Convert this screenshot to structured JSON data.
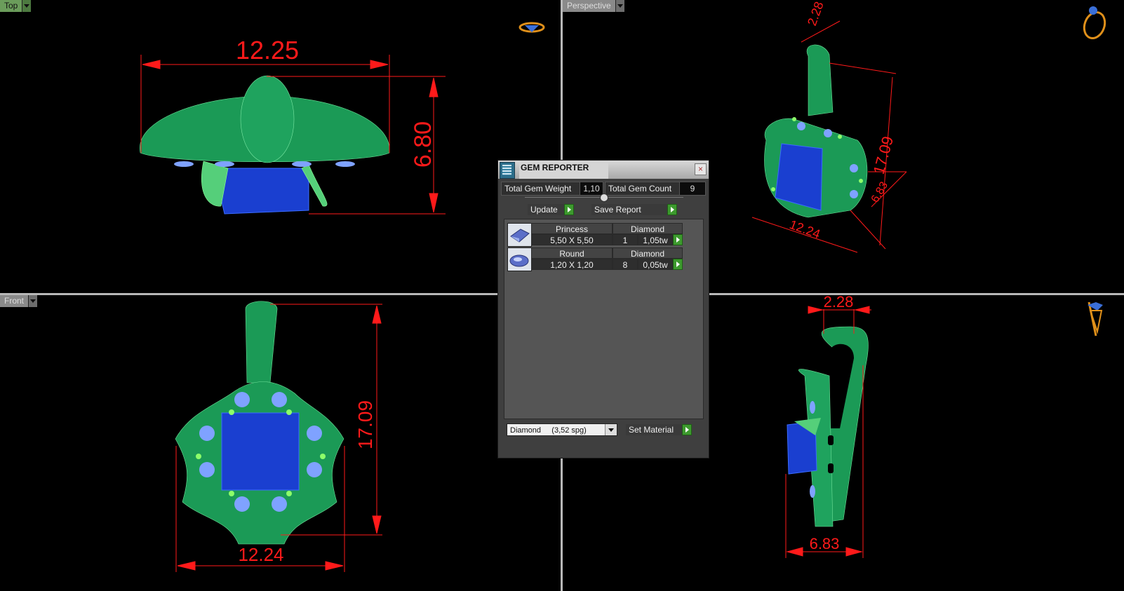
{
  "viewports": {
    "top": {
      "label": "Top"
    },
    "perspective": {
      "label": "Perspective"
    },
    "front": {
      "label": "Front"
    }
  },
  "dimensions": {
    "top_width": "12.25",
    "top_height": "6.80",
    "persp_bail": "2.28",
    "persp_height": "17.09",
    "persp_depth": "6.83",
    "persp_width": "12.24",
    "front_height": "17.09",
    "front_width": "12.24",
    "side_bail": "2.28",
    "side_depth": "6.83"
  },
  "gem_reporter": {
    "title": "GEM REPORTER",
    "close": "×",
    "total_weight_label": "Total Gem Weight",
    "total_weight_value": "1,10",
    "total_count_label": "Total Gem Count",
    "total_count_value": "9",
    "update_label": "Update",
    "save_report_label": "Save Report",
    "gems": [
      {
        "cut": "Princess",
        "material": "Diamond",
        "size": "5,50 X 5,50",
        "count": "1",
        "weight": "1,05tw"
      },
      {
        "cut": "Round",
        "material": "Diamond",
        "size": "1,20 X 1,20",
        "count": "8",
        "weight": "0,05tw"
      }
    ],
    "material_select": "Diamond     (3,52 spg)",
    "set_material_label": "Set Material"
  },
  "colors": {
    "metal": "#1f9a5a",
    "gem_main": "#1a3fd0",
    "gem_small": "#7fa2ff",
    "prong": "#8dff6a",
    "dimension": "#ff1a1a"
  }
}
